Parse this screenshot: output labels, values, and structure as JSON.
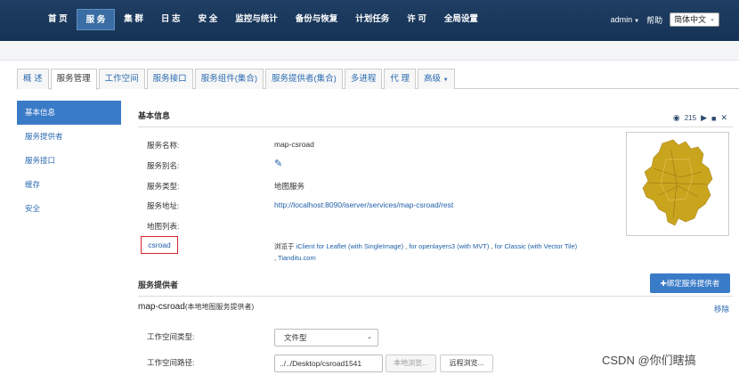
{
  "topnav": {
    "items": [
      "首 页",
      "服 务",
      "集 群",
      "日 志",
      "安 全",
      "监控与统计",
      "备份与恢复",
      "计划任务",
      "许 可",
      "全局设置"
    ],
    "user": "admin",
    "help": "帮助",
    "language": "简体中文"
  },
  "tabs": [
    "概 述",
    "服务管理",
    "工作空间",
    "服务接口",
    "服务组件(集合)",
    "服务提供者(集合)",
    "多进程",
    "代 理",
    "高级"
  ],
  "sidebar": [
    "基本信息",
    "服务提供者",
    "服务接口",
    "缓存",
    "安全"
  ],
  "basic": {
    "title": "基本信息",
    "view_count": "215",
    "rows": [
      {
        "label": "服务名称:",
        "value": "map-csroad"
      },
      {
        "label": "服务别名:",
        "value": ""
      },
      {
        "label": "服务类型:",
        "value": "地图服务"
      },
      {
        "label": "服务地址:",
        "value": "http://localhost:8090/iserver/services/map-csroad/rest"
      },
      {
        "label": "地图列表:",
        "value": ""
      }
    ],
    "map_name": "csroad",
    "preview_prefix": "浏览于",
    "preview_links": [
      "iClient for Leaflet (with SingleImage)",
      "for openlayers3 (with MVT)",
      "for Classic (with Vector Tile)",
      "Tianditu.com"
    ]
  },
  "providers": {
    "title": "服务提供者",
    "bind_button": "绑定服务提供者",
    "provider_name": "map-csroad",
    "provider_type": "(本地地图服务提供者)",
    "remove": "移除",
    "workspace_type_label": "工作空间类型:",
    "workspace_type_value": "文件型",
    "workspace_path_label": "工作空间路径:",
    "workspace_path_value": "../../Desktop/csroad1541",
    "local_browse": "本地浏览...",
    "remote_browse": "远程浏览..."
  },
  "watermark": "CSDN @你们瞎搞",
  "colors": {
    "nav_bg": "#1f3e63",
    "accent": "#3a7bc8",
    "link": "#1f5fa8",
    "highlight": "#d9242b",
    "map_fill": "#c9a51e"
  }
}
